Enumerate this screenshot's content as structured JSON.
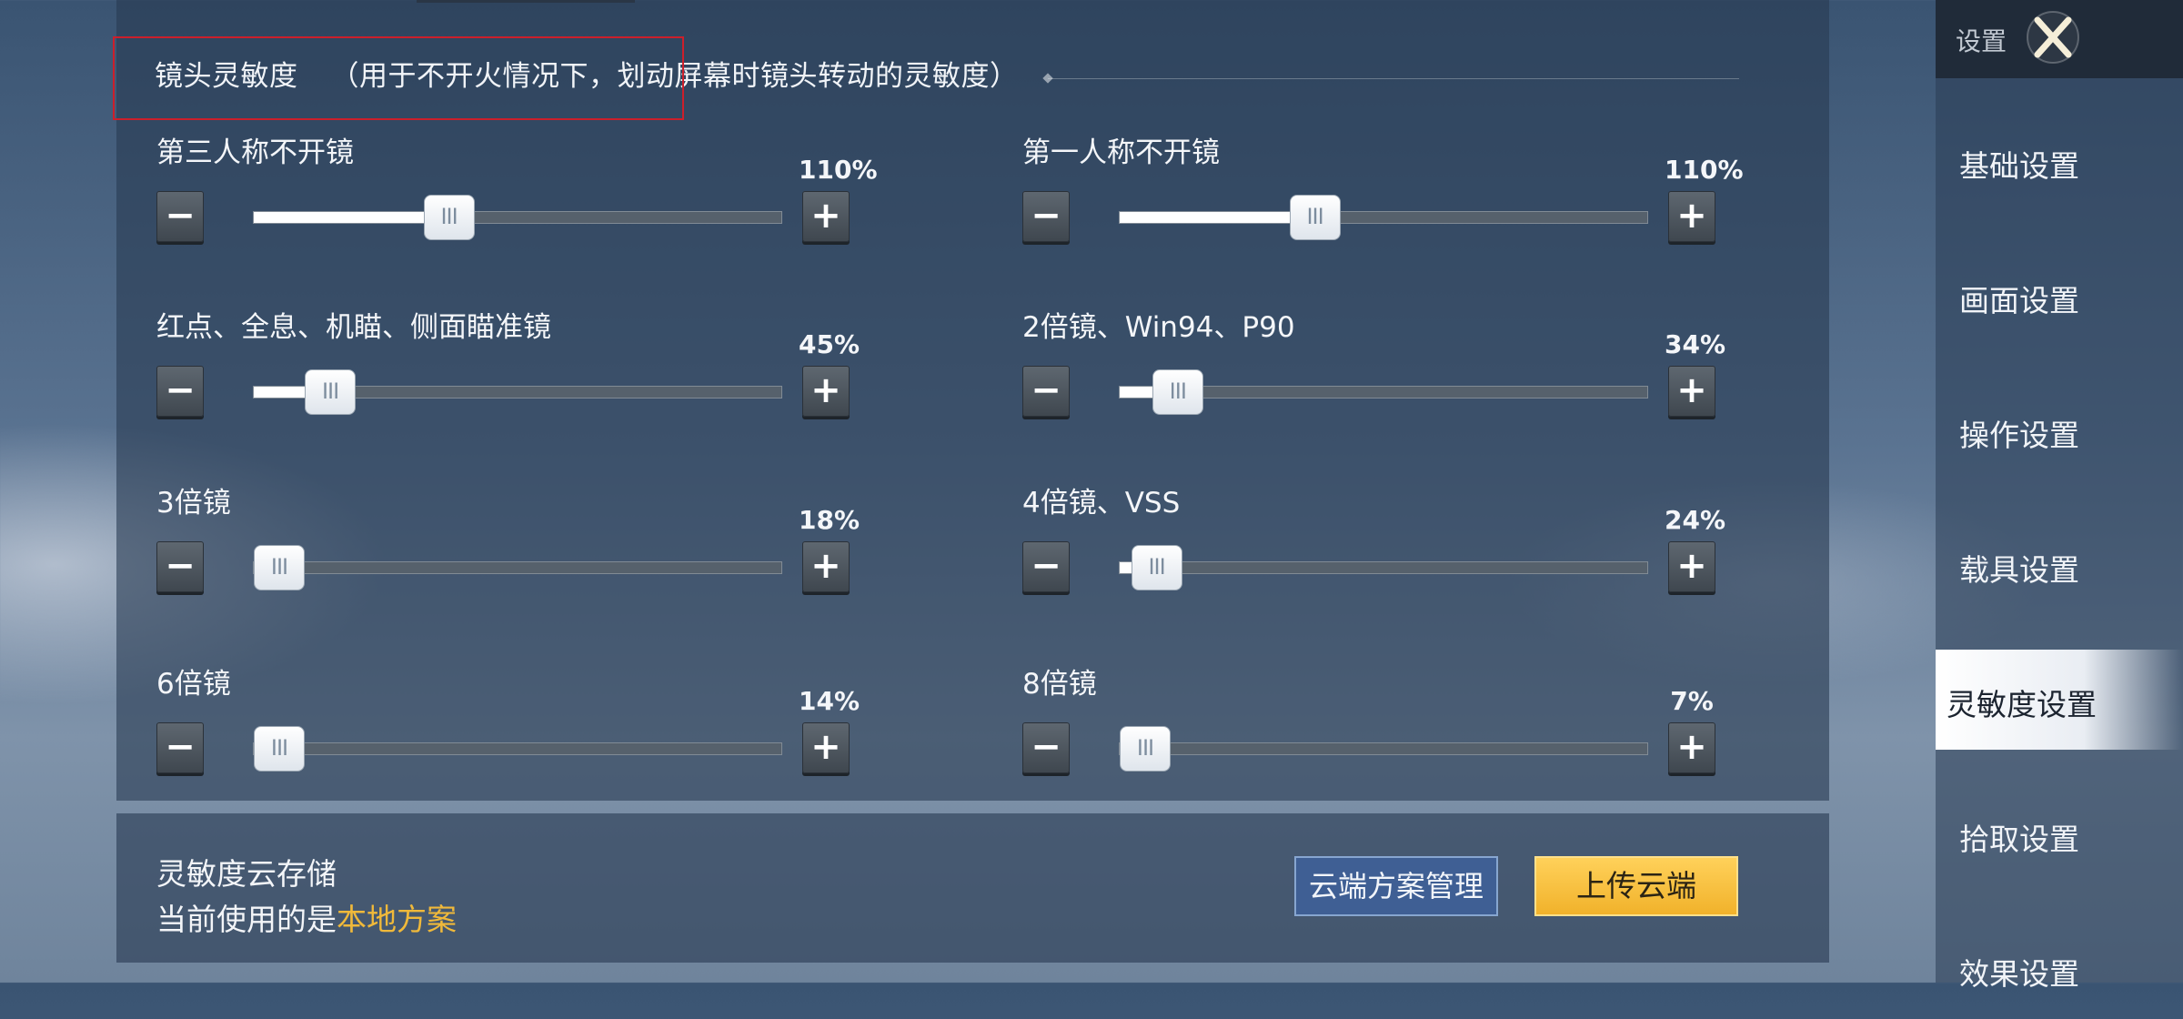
{
  "section": {
    "title": "镜头灵敏度",
    "note": "（用于不开火情况下，划动屏幕时镜头转动的灵敏度）"
  },
  "settings": [
    {
      "label": "第三人称不开镜",
      "value_text": "110%",
      "level": 0.37
    },
    {
      "label": "第一人称不开镜",
      "value_text": "110%",
      "level": 0.37
    },
    {
      "label": "红点、全息、机瞄、侧面瞄准镜",
      "value_text": "45%",
      "level": 0.145
    },
    {
      "label": "2倍镜、Win94、P90",
      "value_text": "34%",
      "level": 0.11
    },
    {
      "label": "3倍镜",
      "value_text": "18%",
      "level": 0.04
    },
    {
      "label": "4倍镜、VSS",
      "value_text": "24%",
      "level": 0.07
    },
    {
      "label": "6倍镜",
      "value_text": "14%",
      "level": 0.04
    },
    {
      "label": "8倍镜",
      "value_text": "7%",
      "level": 0.02
    }
  ],
  "controls": {
    "minus_symbol": "−",
    "plus_symbol": "+",
    "thumb_grip": "III"
  },
  "cloud": {
    "title": "灵敏度云存储",
    "status_prefix": "当前使用的是",
    "status_highlight": "本地方案",
    "manage_label": "云端方案管理",
    "upload_label": "上传云端"
  },
  "sidebar": {
    "title": "设置",
    "items": [
      {
        "label": "基础设置"
      },
      {
        "label": "画面设置"
      },
      {
        "label": "操作设置"
      },
      {
        "label": "载具设置"
      },
      {
        "label": "灵敏度设置"
      },
      {
        "label": "拾取设置"
      },
      {
        "label": "效果设置"
      }
    ],
    "active_index": 4
  },
  "colors": {
    "accent_gold": "#f0b93a",
    "highlight_outline": "#cc1f2b"
  }
}
